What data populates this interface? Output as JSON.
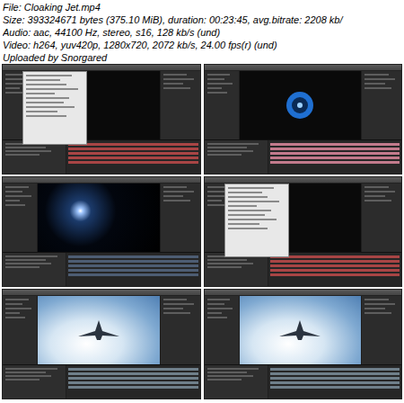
{
  "header": {
    "lines": [
      "File: Cloaking Jet.mp4",
      "Size: 393324671 bytes (375.10 MiB), duration: 00:23:45, avg.bitrate: 2208 kb/",
      "Audio: aac, 44100 Hz, stereo, s16, 128 kb/s (und)",
      "Video: h264, yuv420p, 1280x720, 2072 kb/s, 24.00 fps(r) (und)",
      "Uploaded by Snorgared"
    ]
  },
  "frames": [
    {
      "kind": "menu"
    },
    {
      "kind": "viewer"
    },
    {
      "kind": "stars"
    },
    {
      "kind": "menu"
    },
    {
      "kind": "clouds"
    },
    {
      "kind": "clouds"
    }
  ]
}
